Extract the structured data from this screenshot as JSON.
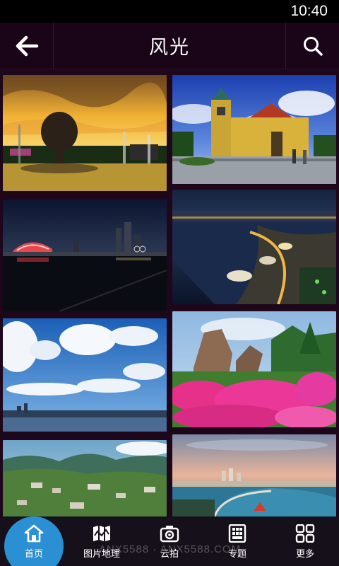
{
  "status": {
    "time": "10:40"
  },
  "header": {
    "title": "风光",
    "back_icon": "back-arrow-icon",
    "search_icon": "search-icon"
  },
  "photos": [
    {
      "name": "photo-sculpture-sunset"
    },
    {
      "name": "photo-church-blue-sky"
    },
    {
      "name": "photo-night-stadium"
    },
    {
      "name": "photo-night-coastline"
    },
    {
      "name": "photo-sea-clouds"
    },
    {
      "name": "photo-rocks-pink-flowers"
    },
    {
      "name": "photo-mountains-village"
    },
    {
      "name": "photo-harbor-dusk"
    }
  ],
  "nav": {
    "items": [
      {
        "label": "首页",
        "icon": "home-icon",
        "active": true
      },
      {
        "label": "图片地理",
        "icon": "map-icon",
        "active": false
      },
      {
        "label": "云拍",
        "icon": "camera-icon",
        "active": false
      },
      {
        "label": "专题",
        "icon": "topic-icon",
        "active": false
      },
      {
        "label": "更多",
        "icon": "more-grid-icon",
        "active": false
      }
    ]
  },
  "watermark": "ANX5588 · ANX5588.COM"
}
